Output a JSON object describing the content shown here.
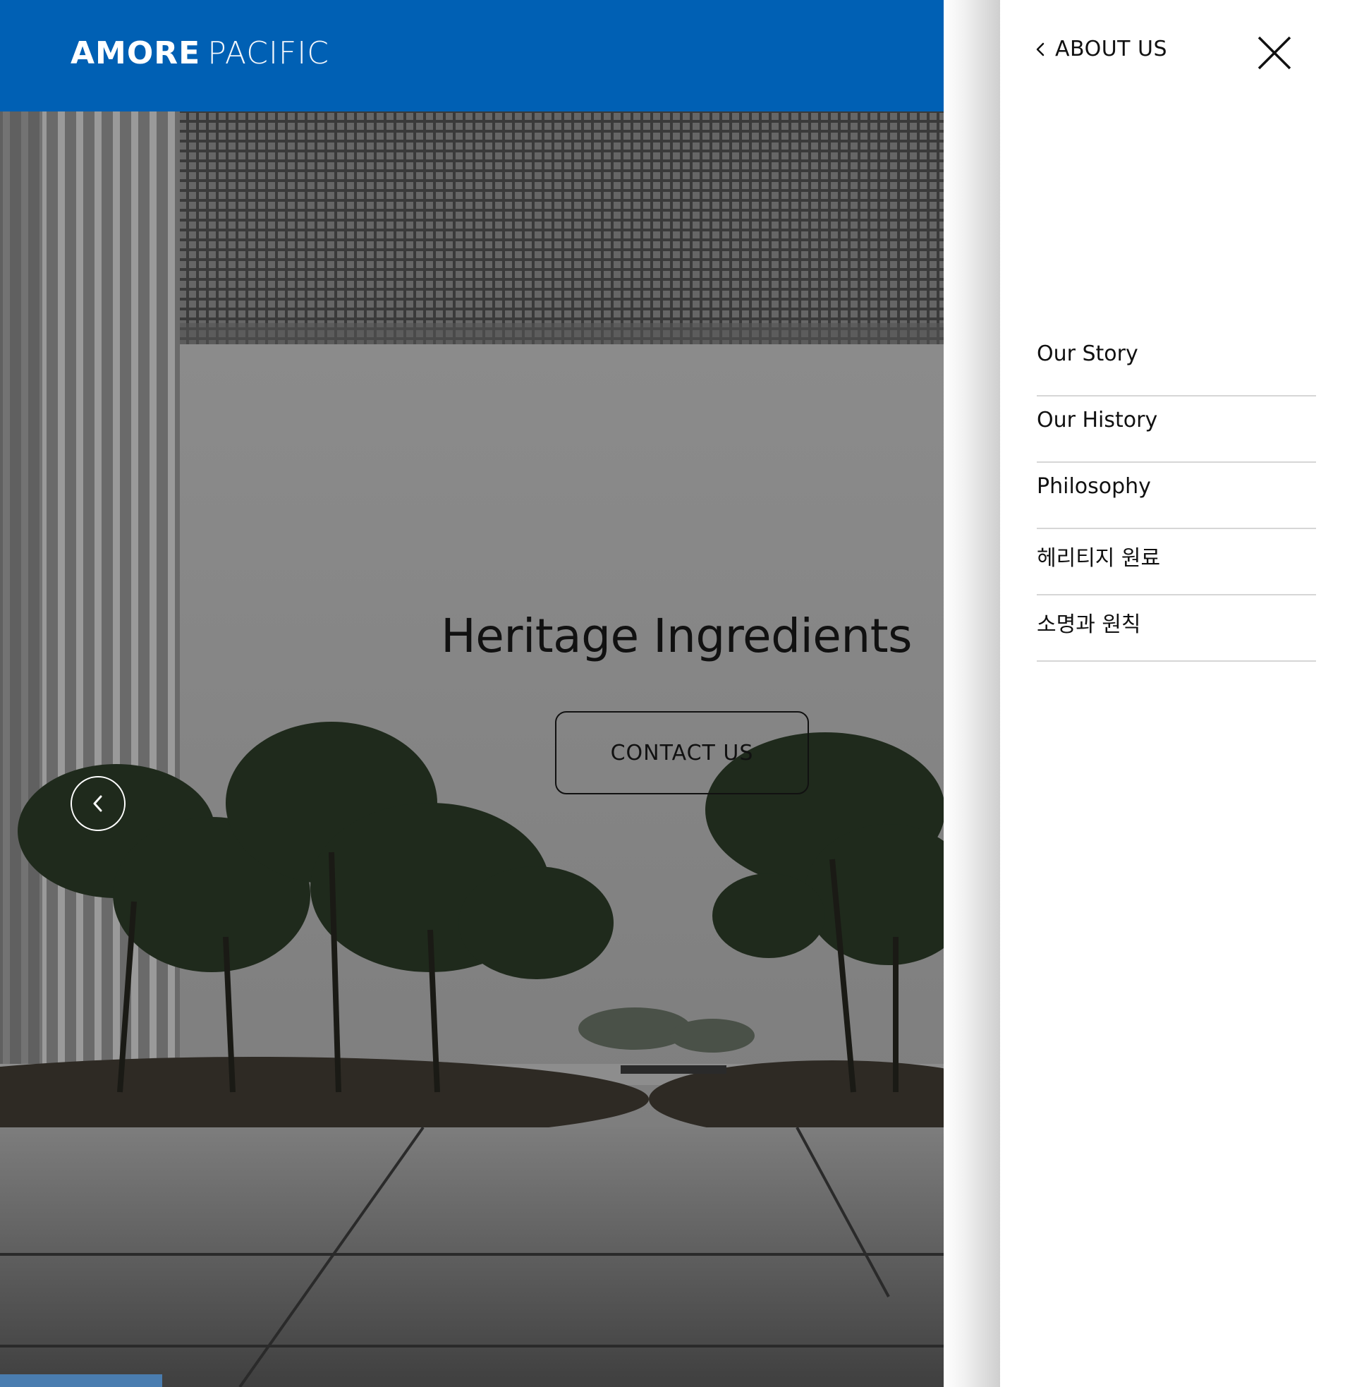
{
  "brand": {
    "logo_left": "AMORE",
    "logo_right": "PACIFIC",
    "color": "#0060b4"
  },
  "hero": {
    "title": "Heritage Ingredients",
    "cta_label": "CONTACT US",
    "prev_icon": "chevron-left-icon"
  },
  "menu_panel": {
    "back_icon": "chevron-left-icon",
    "title": "ABOUT US",
    "close_icon": "close-icon",
    "items": [
      {
        "label": "Our Story"
      },
      {
        "label": "Our History"
      },
      {
        "label": "Philosophy"
      },
      {
        "label": "헤리티지 원료"
      },
      {
        "label": "소명과 원칙"
      }
    ]
  }
}
